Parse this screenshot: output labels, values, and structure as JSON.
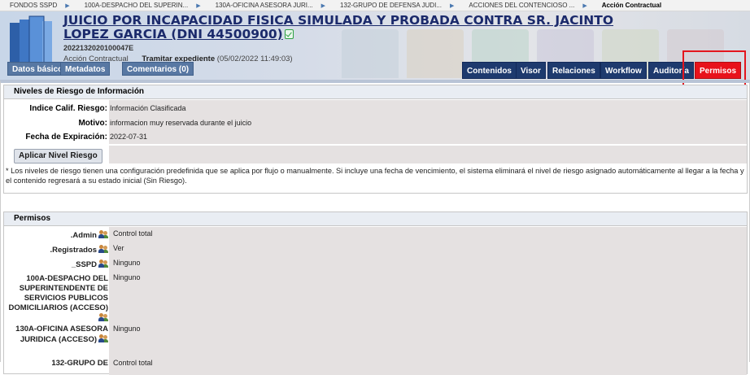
{
  "breadcrumb": [
    "FONDOS SSPD",
    "100A-DESPACHO DEL SUPERIN...",
    "130A-OFICINA ASESORA JURI...",
    "132-GRUPO DE DEFENSA JUDI...",
    "ACCIONES DEL CONTENCIOSO ...",
    "Acción Contractual"
  ],
  "document": {
    "title": "JUICIO POR INCAPACIDAD FISICA SIMULADA Y PROBADA CONTRA SR. JACINTO LOPEZ GARCIA (DNI 44500900)",
    "code": "2022132020100047E",
    "type": "Acción Contractual",
    "state": "Tramitar expediente",
    "state_date": "(05/02/2022 11:49:03)"
  },
  "tabs_left": [
    "Datos básicos",
    "Metadatos",
    "Comentarios (0)"
  ],
  "tabs_right": [
    "Contenidos",
    "Visor",
    "Relaciones",
    "Workflow",
    "Auditoría",
    "Permisos"
  ],
  "active_tab": "Permisos",
  "risk": {
    "heading": "Niveles de Riesgo de Información",
    "index_label": "Indice Calif. Riesgo:",
    "index_value": "Información Clasificada",
    "reason_label": "Motivo:",
    "reason_value": "informacion muy reservada durante el juicio",
    "expiry_label": "Fecha de Expiración:",
    "expiry_value": "2022-07-31",
    "apply_button": "Aplicar Nivel Riesgo",
    "note": "* Los niveles de riesgo tienen una configuración predefinida que se aplica por flujo o manualmente. Si incluye una fecha de vencimiento, el sistema eliminará el nivel de riesgo asignado automáticamente al llegar a la fecha y el contenido regresará a su estado inicial (Sin Riesgo)."
  },
  "permissions": {
    "heading": "Permisos",
    "rows": [
      {
        "label": ".Admin",
        "value": "Control total"
      },
      {
        "label": ".Registrados",
        "value": "Ver"
      },
      {
        "label": "_SSPD",
        "value": "Ninguno"
      },
      {
        "label": "100A-DESPACHO DEL SUPERINTENDENTE DE SERVICIOS PUBLICOS DOMICILIARIOS (ACCESO)",
        "value": "Ninguno"
      },
      {
        "label": "130A-OFICINA ASESORA JURIDICA (ACCESO)",
        "value": "Ninguno"
      },
      {
        "label": "132-GRUPO DE",
        "value": "Control total"
      }
    ]
  }
}
